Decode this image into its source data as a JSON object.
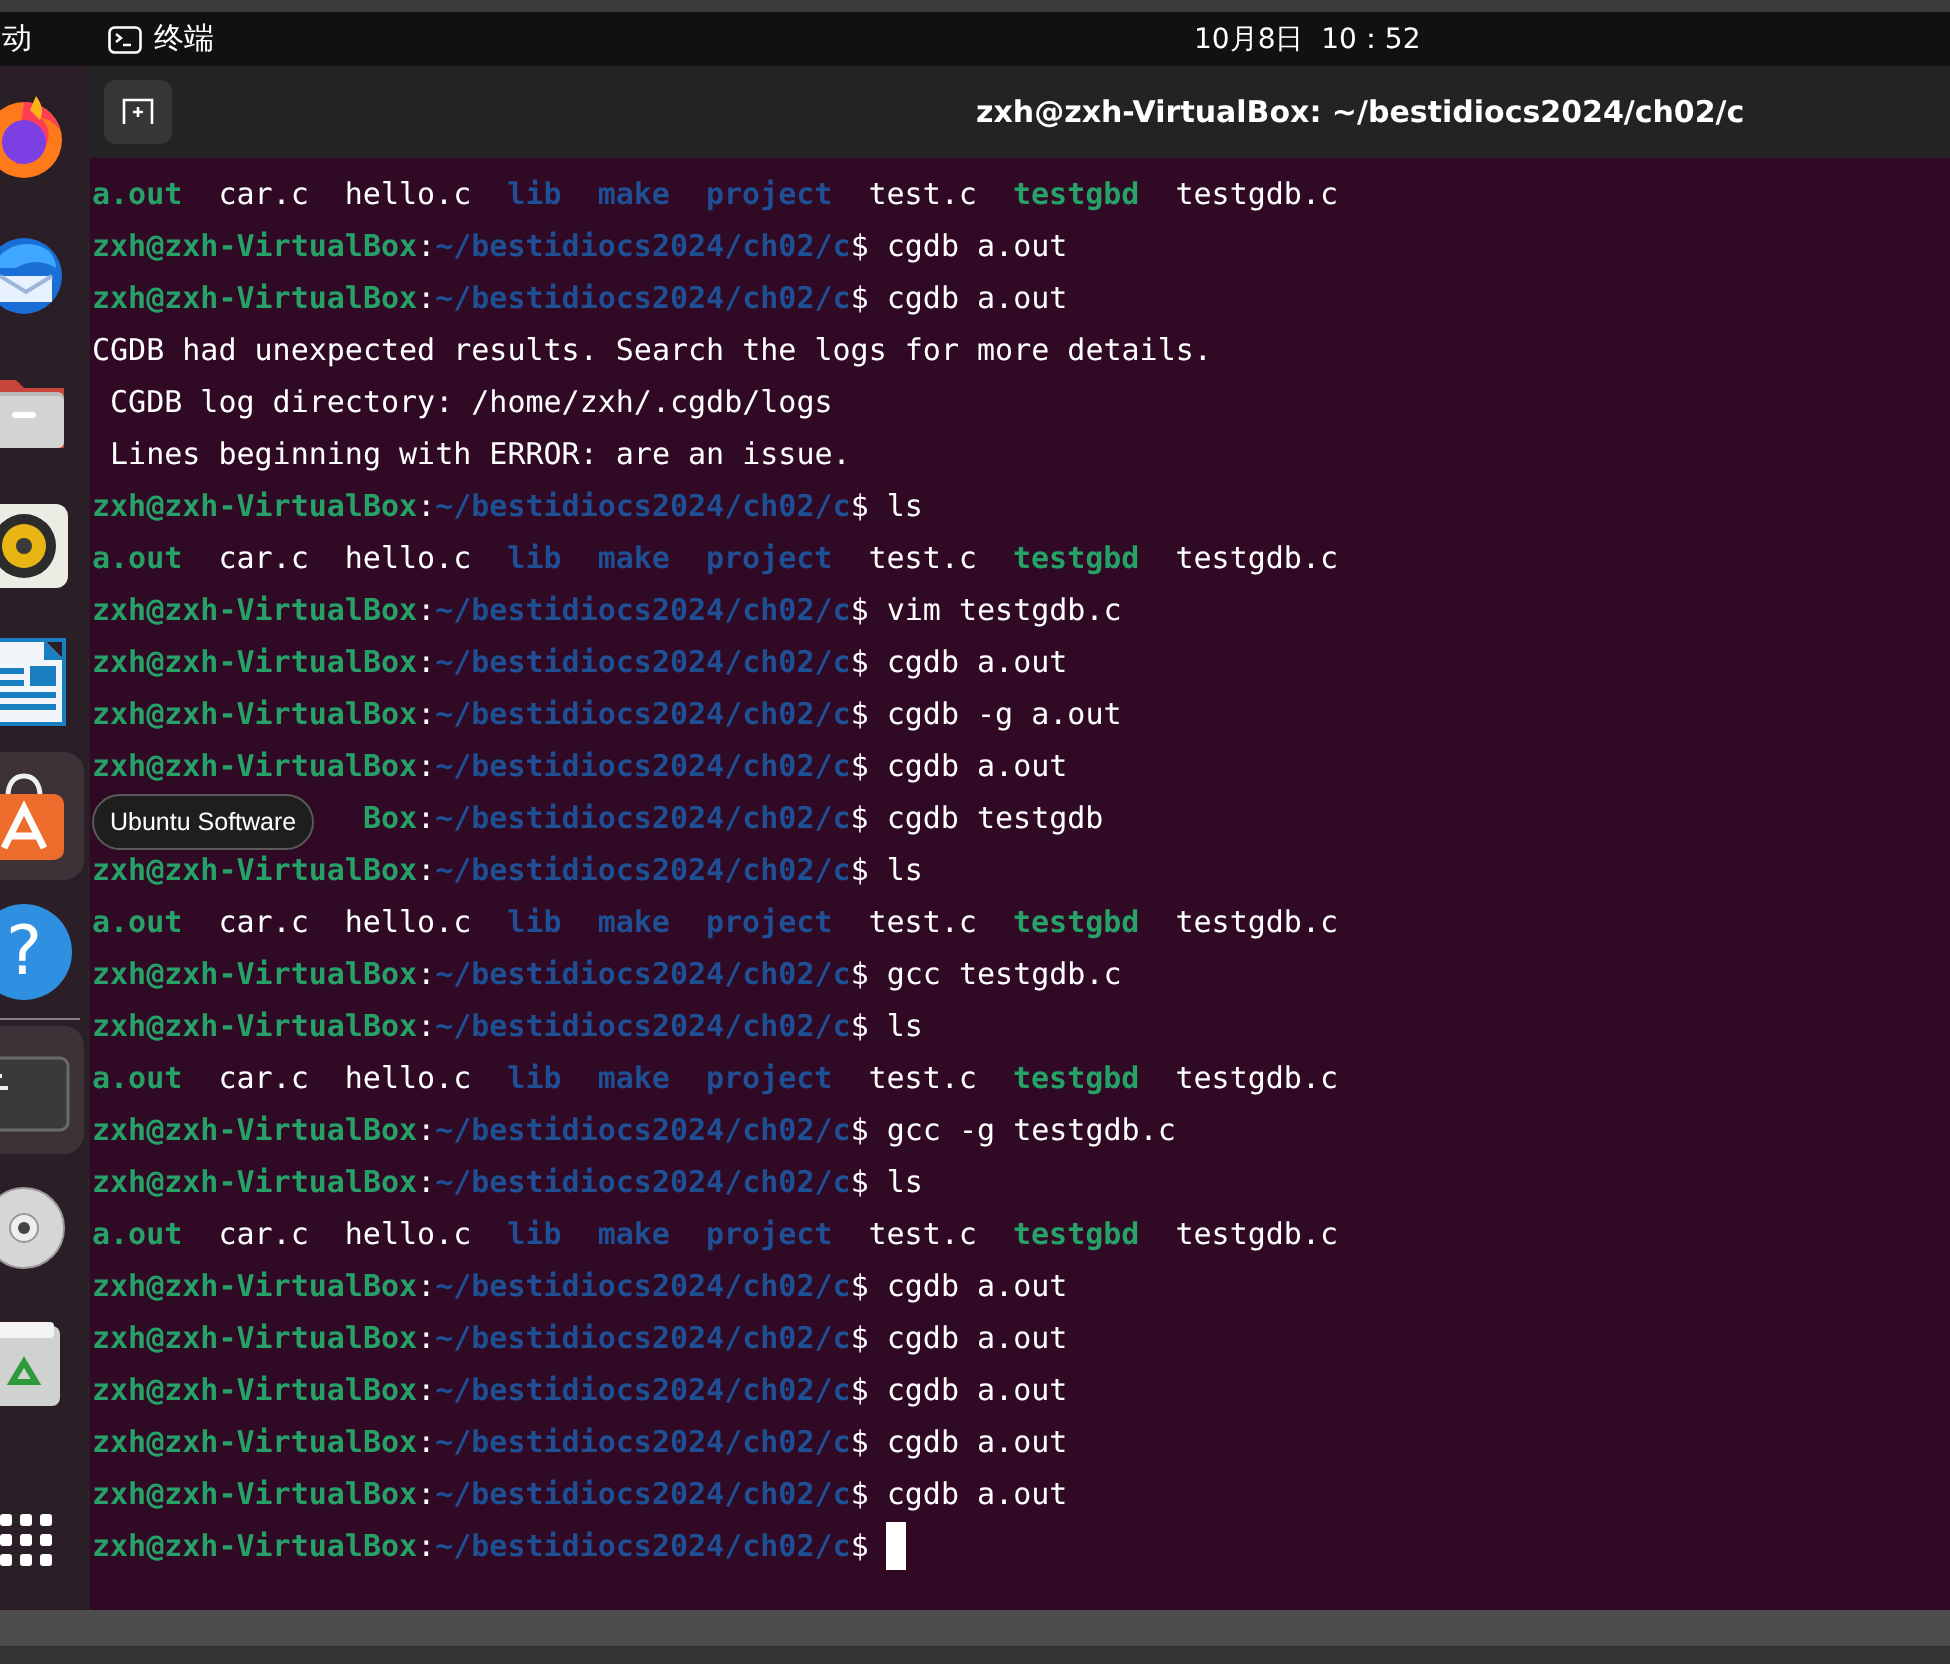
{
  "top_bar": {
    "activities": "动",
    "app_name": "终端",
    "clock": "10月8日  10：52"
  },
  "dock": {
    "items": [
      {
        "kind": "browser",
        "highlighted": false
      },
      {
        "kind": "mail",
        "highlighted": false
      },
      {
        "kind": "files",
        "highlighted": false
      },
      {
        "kind": "music",
        "highlighted": false
      },
      {
        "kind": "document",
        "highlighted": false
      },
      {
        "kind": "store",
        "highlighted": true
      },
      {
        "kind": "help",
        "highlighted": false,
        "glyph": "?"
      },
      {
        "kind": "separator"
      },
      {
        "kind": "terminal",
        "highlighted": true
      },
      {
        "kind": "disc",
        "highlighted": false
      },
      {
        "kind": "trash",
        "highlighted": false
      },
      {
        "kind": "apps",
        "highlighted": false
      }
    ],
    "tooltip": "Ubuntu Software"
  },
  "window": {
    "title": "zxh@zxh-VirtualBox: ~/bestidiocs2024/ch02/c"
  },
  "terminal": {
    "lines": [
      {
        "kind": "listing",
        "entries": [
          {
            "text": "a.out",
            "kind": "exec"
          },
          {
            "text": "car.c",
            "kind": "file"
          },
          {
            "text": "hello.c",
            "kind": "file"
          },
          {
            "text": "lib",
            "kind": "dir"
          },
          {
            "text": "make",
            "kind": "dir"
          },
          {
            "text": "project",
            "kind": "dir"
          },
          {
            "text": "test.c",
            "kind": "file"
          },
          {
            "text": "testgbd",
            "kind": "exec"
          },
          {
            "text": "testgdb.c",
            "kind": "file"
          }
        ]
      },
      {
        "kind": "prompt",
        "user": "zxh@zxh-VirtualBox",
        "colon": ":",
        "path": "~/bestidiocs2024/ch02/c",
        "sign": "$",
        "command": "cgdb a.out"
      },
      {
        "kind": "prompt",
        "user": "zxh@zxh-VirtualBox",
        "colon": ":",
        "path": "~/bestidiocs2024/ch02/c",
        "sign": "$",
        "command": "cgdb a.out"
      },
      {
        "kind": "output",
        "text": "CGDB had unexpected results. Search the logs for more details."
      },
      {
        "kind": "output",
        "text": " CGDB log directory: /home/zxh/.cgdb/logs"
      },
      {
        "kind": "output",
        "text": " Lines beginning with ERROR: are an issue."
      },
      {
        "kind": "prompt",
        "user": "zxh@zxh-VirtualBox",
        "colon": ":",
        "path": "~/bestidiocs2024/ch02/c",
        "sign": "$",
        "command": "ls"
      },
      {
        "kind": "listing",
        "entries": [
          {
            "text": "a.out",
            "kind": "exec"
          },
          {
            "text": "car.c",
            "kind": "file"
          },
          {
            "text": "hello.c",
            "kind": "file"
          },
          {
            "text": "lib",
            "kind": "dir"
          },
          {
            "text": "make",
            "kind": "dir"
          },
          {
            "text": "project",
            "kind": "dir"
          },
          {
            "text": "test.c",
            "kind": "file"
          },
          {
            "text": "testgbd",
            "kind": "exec"
          },
          {
            "text": "testgdb.c",
            "kind": "file"
          }
        ]
      },
      {
        "kind": "prompt",
        "user": "zxh@zxh-VirtualBox",
        "colon": ":",
        "path": "~/bestidiocs2024/ch02/c",
        "sign": "$",
        "command": "vim testgdb.c"
      },
      {
        "kind": "prompt",
        "user": "zxh@zxh-VirtualBox",
        "colon": ":",
        "path": "~/bestidiocs2024/ch02/c",
        "sign": "$",
        "command": "cgdb a.out"
      },
      {
        "kind": "prompt",
        "user": "zxh@zxh-VirtualBox",
        "colon": ":",
        "path": "~/bestidiocs2024/ch02/c",
        "sign": "$",
        "command": "cgdb -g a.out"
      },
      {
        "kind": "prompt",
        "user": "zxh@zxh-VirtualBox",
        "colon": ":",
        "path": "~/bestidiocs2024/ch02/c",
        "sign": "$",
        "command": "cgdb a.out"
      },
      {
        "kind": "prompt",
        "user": "Box",
        "colon": ":",
        "path": "~/bestidiocs2024/ch02/c",
        "sign": "$",
        "command": "cgdb testgdb",
        "under_tooltip": true
      },
      {
        "kind": "prompt",
        "user": "zxh@zxh-VirtualBox",
        "colon": ":",
        "path": "~/bestidiocs2024/ch02/c",
        "sign": "$",
        "command": "ls"
      },
      {
        "kind": "listing",
        "entries": [
          {
            "text": "a.out",
            "kind": "exec"
          },
          {
            "text": "car.c",
            "kind": "file"
          },
          {
            "text": "hello.c",
            "kind": "file"
          },
          {
            "text": "lib",
            "kind": "dir"
          },
          {
            "text": "make",
            "kind": "dir"
          },
          {
            "text": "project",
            "kind": "dir"
          },
          {
            "text": "test.c",
            "kind": "file"
          },
          {
            "text": "testgbd",
            "kind": "exec"
          },
          {
            "text": "testgdb.c",
            "kind": "file"
          }
        ]
      },
      {
        "kind": "prompt",
        "user": "zxh@zxh-VirtualBox",
        "colon": ":",
        "path": "~/bestidiocs2024/ch02/c",
        "sign": "$",
        "command": "gcc testgdb.c"
      },
      {
        "kind": "prompt",
        "user": "zxh@zxh-VirtualBox",
        "colon": ":",
        "path": "~/bestidiocs2024/ch02/c",
        "sign": "$",
        "command": "ls"
      },
      {
        "kind": "listing",
        "entries": [
          {
            "text": "a.out",
            "kind": "exec"
          },
          {
            "text": "car.c",
            "kind": "file"
          },
          {
            "text": "hello.c",
            "kind": "file"
          },
          {
            "text": "lib",
            "kind": "dir"
          },
          {
            "text": "make",
            "kind": "dir"
          },
          {
            "text": "project",
            "kind": "dir"
          },
          {
            "text": "test.c",
            "kind": "file"
          },
          {
            "text": "testgbd",
            "kind": "exec"
          },
          {
            "text": "testgdb.c",
            "kind": "file"
          }
        ]
      },
      {
        "kind": "prompt",
        "user": "zxh@zxh-VirtualBox",
        "colon": ":",
        "path": "~/bestidiocs2024/ch02/c",
        "sign": "$",
        "command": "gcc -g testgdb.c"
      },
      {
        "kind": "prompt",
        "user": "zxh@zxh-VirtualBox",
        "colon": ":",
        "path": "~/bestidiocs2024/ch02/c",
        "sign": "$",
        "command": "ls"
      },
      {
        "kind": "listing",
        "entries": [
          {
            "text": "a.out",
            "kind": "exec"
          },
          {
            "text": "car.c",
            "kind": "file"
          },
          {
            "text": "hello.c",
            "kind": "file"
          },
          {
            "text": "lib",
            "kind": "dir"
          },
          {
            "text": "make",
            "kind": "dir"
          },
          {
            "text": "project",
            "kind": "dir"
          },
          {
            "text": "test.c",
            "kind": "file"
          },
          {
            "text": "testgbd",
            "kind": "exec"
          },
          {
            "text": "testgdb.c",
            "kind": "file"
          }
        ]
      },
      {
        "kind": "prompt",
        "user": "zxh@zxh-VirtualBox",
        "colon": ":",
        "path": "~/bestidiocs2024/ch02/c",
        "sign": "$",
        "command": "cgdb a.out"
      },
      {
        "kind": "prompt",
        "user": "zxh@zxh-VirtualBox",
        "colon": ":",
        "path": "~/bestidiocs2024/ch02/c",
        "sign": "$",
        "command": "cgdb a.out"
      },
      {
        "kind": "prompt",
        "user": "zxh@zxh-VirtualBox",
        "colon": ":",
        "path": "~/bestidiocs2024/ch02/c",
        "sign": "$",
        "command": "cgdb a.out"
      },
      {
        "kind": "prompt",
        "user": "zxh@zxh-VirtualBox",
        "colon": ":",
        "path": "~/bestidiocs2024/ch02/c",
        "sign": "$",
        "command": "cgdb a.out"
      },
      {
        "kind": "prompt",
        "user": "zxh@zxh-VirtualBox",
        "colon": ":",
        "path": "~/bestidiocs2024/ch02/c",
        "sign": "$",
        "command": "cgdb a.out"
      },
      {
        "kind": "prompt",
        "user": "zxh@zxh-VirtualBox",
        "colon": ":",
        "path": "~/bestidiocs2024/ch02/c",
        "sign": "$",
        "cursor": true
      }
    ]
  }
}
